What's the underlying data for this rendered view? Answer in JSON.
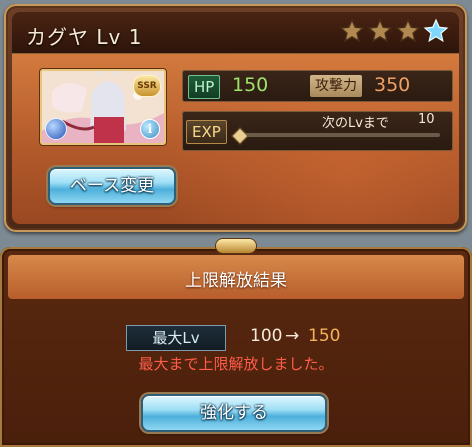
{
  "character": {
    "name": "カグヤ",
    "level_label": "Lv 1",
    "rarity": "SSR",
    "stars": [
      {
        "state": "bronze",
        "color": "#b08850"
      },
      {
        "state": "bronze",
        "color": "#b08850"
      },
      {
        "state": "bronze",
        "color": "#b08850"
      },
      {
        "state": "active",
        "color": "#7fd6ff"
      }
    ],
    "info_glyph": "i"
  },
  "stats": {
    "hp_label": "HP",
    "hp_value": "150",
    "attack_label": "攻撃力",
    "attack_value": "350",
    "exp_label": "EXP",
    "next_label": "次のLvまで",
    "next_value": "10",
    "exp_progress": 0
  },
  "buttons": {
    "base_change": "ベース変更",
    "enhance": "強化する"
  },
  "result": {
    "title": "上限解放結果",
    "max_level_label": "最大Lv",
    "level_before": "100",
    "arrow": "→",
    "level_after": "150",
    "message": "最大まで上限解放しました。"
  },
  "colors": {
    "hp_value": "#9ee36a",
    "attack_value": "#f0a060",
    "level_after": "#f5b15a",
    "message": "#ff5c4a"
  }
}
